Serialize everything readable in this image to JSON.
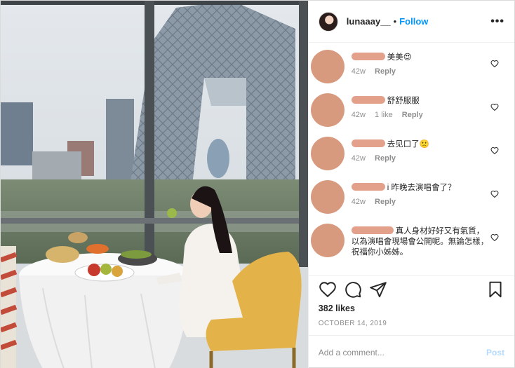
{
  "header": {
    "username": "lunaaay__",
    "separator": "•",
    "follow_label": "Follow",
    "more_label": "•••"
  },
  "comments": [
    {
      "text": "美美😍",
      "age": "42w",
      "likes": "",
      "reply_label": "Reply"
    },
    {
      "text": "舒舒服服",
      "age": "42w",
      "likes": "1 like",
      "reply_label": "Reply"
    },
    {
      "text": "去见口了🙁",
      "age": "42w",
      "likes": "",
      "reply_label": "Reply"
    },
    {
      "text": "i 昨晚去演唱會了？",
      "age": "42w",
      "likes": "",
      "reply_label": "Reply"
    },
    {
      "text": "真人身材好好又有氣質，以為演唱會現場會公開呢。無論怎樣，祝福你小姊姊。",
      "age": "",
      "likes": "",
      "reply_label": ""
    }
  ],
  "post": {
    "likes": "382 likes",
    "date": "OCTOBER 14, 2019"
  },
  "add_comment": {
    "placeholder": "Add a comment...",
    "post_label": "Post"
  },
  "colors": {
    "accent": "#0095f6",
    "post_disabled": "#b3dbff",
    "redaction": "#d89a7e"
  },
  "icons": [
    "heart-icon",
    "comment-icon",
    "share-icon",
    "bookmark-icon"
  ]
}
